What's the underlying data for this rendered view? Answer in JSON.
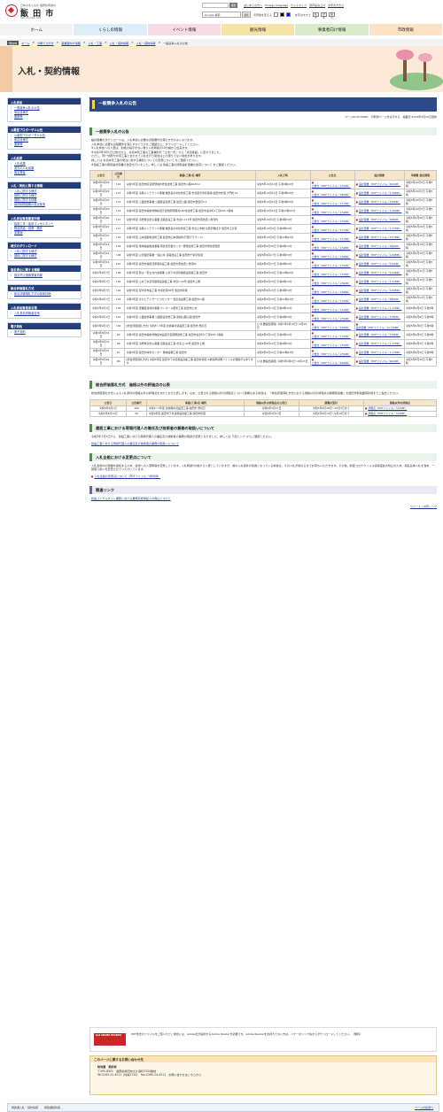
{
  "header": {
    "city_small": "日本のまんなか 長野県南信州 信州",
    "city_name": "飯 田 市",
    "city_en": "Iida City Web Site",
    "search_button": "検索",
    "top_links": [
      "はじめての方へ",
      "Foreign language",
      "サイトマップ",
      "音声読み上げ",
      "文字の大きさ"
    ],
    "google_label": "Google 検索",
    "google_button": "検索",
    "color_label": "背景色を変える",
    "font_label": "文字の大きさ",
    "font_buttons": [
      "拡大",
      "標準",
      "縮小"
    ]
  },
  "gnav": [
    {
      "label": "ホーム",
      "color": "#f3f3f3"
    },
    {
      "label": "くらしの情報",
      "color": "#ddeef9"
    },
    {
      "label": "イベント情報",
      "color": "#f7dce6"
    },
    {
      "label": "観光情報",
      "color": "#f6e3a8"
    },
    {
      "label": "事業者向け情報",
      "color": "#d9ebc8"
    },
    {
      "label": "市政情報",
      "color": "#fde2c4"
    }
  ],
  "breadcrumb": {
    "current": "現在地",
    "items": [
      "ホーム",
      "分類でさがす",
      "事業者向け情報",
      "入札・工事",
      "入札・契約情報",
      "入札・契約情報",
      "一般競争入札の公告"
    ]
  },
  "banner_title": "入札・契約情報",
  "sidebar": [
    {
      "title": "入札参加",
      "items": [
        "一般競争入札の公告",
        "申請書様式",
        "要綱等"
      ]
    },
    {
      "title": "公募型プロポーザル公告",
      "items": [
        "公募型プロポーザル公告",
        "申請書様式",
        "要綱等"
      ]
    },
    {
      "title": "入札結果",
      "items": [
        "入札結果",
        "過去の入札結果",
        "指名業者"
      ]
    },
    {
      "title": "入札・契約に関する情報",
      "items": [
        "入札に関する様式",
        "契約に関する様式",
        "契約に関する情報",
        "最低制限価格の設定基準"
      ]
    },
    {
      "title": "入札参加資格審査申請",
      "items": [
        "建設工事・建設コンサルタント",
        "物品供給・役務・委託",
        "変更届"
      ]
    },
    {
      "title": "様式のダウンロード",
      "items": [
        "入札に関する様式",
        "契約に関する様式"
      ]
    },
    {
      "title": "指名停止に関する情報",
      "items": [
        "指名停止措置業者情報"
      ]
    },
    {
      "title": "総合評価落札方式",
      "items": [
        "総合評価落札方式の技術評価"
      ]
    },
    {
      "title": "入札参加資格者名簿",
      "items": [
        "入札参加資格者名簿"
      ]
    },
    {
      "title": "電子契約",
      "items": [
        "電子契約"
      ]
    }
  ],
  "main": {
    "page_title": "一般競争入札の公告",
    "page_meta": "ページID:0079687　印刷用ページを表示する　掲載日:2023年9月29日更新",
    "sec1_title": "一般競争入札の公告",
    "sec1_text": [
      "設計図書のダウンロードは、入札参加に必要な資格要件を満たす方のみとなります。",
      "入札参加に必要な資格要件を満たすかどうかをご確認の上、ダウンロードしてください。",
      "※入札参加への入室は、別紙の指示がない限り入札時間の10分前から出来ます。",
      "※令和3年4月1日公告分から、水道本管工事の工事種別が「土木一式」から「水道施設」に変わりました。",
      "ただし、同一箇所や水道工事と合わせて入札を行う場合はこの限りでない場合があります。",
      "詳しくは 水道本管工事の発注に関する種別についての変更について をご確認ください。",
      "※建設工事の閲覧設計図書の改定を行いました。詳しくは 建設工事の閲覧設計図書の改定について をご確認ください。"
    ],
    "table_headers": [
      "公告日",
      "公告番号",
      "事業(工事)名 場所",
      "入札日時",
      "公告文",
      "設計図書",
      "申請書 提出期限"
    ],
    "rows": [
      {
        "date": "令和5年9月29日",
        "no": "116",
        "name": "令和5年度 飯田市区道能登線外修性改修工事 飯田市川路6428-2",
        "bid": "令和5年10月10日 午前9時30分",
        "notice": "公告文（PDFファイル／175KB）",
        "design": "設計図書（PDFファイル／400KB）",
        "deadline": "令和5年10月3日 午後5時"
      },
      {
        "date": "令和5年9月29日",
        "no": "115",
        "name": "令和5年度 滝路メンテナンス事業 橋梁長寿命化修繕工事 市道座光寺松尾線 飯田市松尾 大門町15",
        "bid": "令和5年10月10日 午前9時30分",
        "notice": "公告文（PDFファイル／180KB）",
        "design": "設計図書（PDFファイル／4.49MB）",
        "deadline": "令和5年10月3日 午後5時"
      },
      {
        "date": "令和5年9月29日",
        "no": "114",
        "name": "令和5年度 公園改修事業 公園施設改修工事 飯田公園 飯田市愛宕町2-1",
        "bid": "令和5年10月10日 午前9時50分",
        "notice": "公告文（PDFファイル／177KB）",
        "design": "設計図書（PDFファイル／376KB）",
        "deadline": "令和5年10月3日 午後5時"
      },
      {
        "date": "令和5年9月29日",
        "no": "113",
        "name": "令和5年度 飯田市美術博物館展示室他照明器具LED化改修工事 飯田市追手町2丁目655-7番地",
        "bid": "令和5年10月10日 午前10時10分",
        "notice": "公告文（PDFファイル／174KB）",
        "design": "設計図書（PDFファイル／3.26MB）",
        "deadline": "令和5年10月3日 午後5時"
      },
      {
        "date": "令和5年9月22日",
        "no": "112",
        "name": "令和5年度 滝壁緊急防災事業 道路改良工事 市道3-173号 飯田市南信濃八重河内",
        "bid": "令和5年10月4日 午前9時30分",
        "notice": "公告文（PDFファイル／175KB）",
        "design": "設計図書（PDFファイル／458KB）",
        "deadline": "令和5年9月26日 午後5時"
      },
      {
        "date": "令和5年9月22日",
        "no": "111",
        "name": "令和5年度 滝路メンテナンス事業 橋梁長寿命化修繕工事 市道上中線 鳥居沢橋ほか 飯田市上久堅",
        "bid": "令和5年10月4日 午前9時50分",
        "notice": "公告文（PDFファイル／177KB）",
        "design": "設計図書（PDFファイル／1.37MB）",
        "deadline": "令和5年9月26日 午後5時"
      },
      {
        "date": "令和5年9月22日",
        "no": "110",
        "name": "令和5年度 山本運動場改修工事 飯田市山本運動場(芦部グラウンド)",
        "bid": "令和5年10月4日 午前10時10分",
        "notice": "公告文（PDFファイル／177KB）",
        "design": "設計図書（PDFファイル／3.07MB）",
        "deadline": "令和5年9月26日 午後5時"
      },
      {
        "date": "令和5年9月14日",
        "no": "109",
        "name": "令和5年度 地域福祉推進事業 南信濃児童センター屋根改修工事 飯田市南信濃和田",
        "bid": "令和5年9月26日 午前9時30分",
        "notice": "公告文（PDFファイル／174KB）",
        "design": "設計図書（PDFファイル／284KB）",
        "deadline": "令和5年9月19日 午後5時"
      },
      {
        "date": "令和5年9月14日",
        "no": "108",
        "name": "令和5年度 災害復旧事業 一般公共 道路改良工事 飯田市千栄字佐間",
        "bid": "令和5年9月27日 午前9時30分",
        "notice": "公告文（PDFファイル／178KB）",
        "design": "設計図書（PDFファイル／1.09MB）",
        "deadline": "令和5年9月19日 午後5時"
      },
      {
        "date": "令和5年9月14日",
        "no": "107",
        "name": "令和5年度 飯田市消防団車庫新設工事 飯田市南信濃八重河内",
        "bid": "令和5年9月27日 午前9時50分",
        "notice": "公告文（PDFファイル／175KB）",
        "design": "設計図書（PDFファイル／512KB）",
        "deadline": "令和5年9月19日 午後5時"
      },
      {
        "date": "令和5年9月7日",
        "no": "106",
        "name": "令和5年度 防災・安全交付金事業 公共下水道管路施設改築工事 飯田市",
        "bid": "令和5年9月20日 午前10時00分",
        "notice": "公告文（PDFファイル／173KB）",
        "design": "設計図書（PDFファイル／9.04MB）",
        "deadline": "令和5年9月12日 午後5時"
      },
      {
        "date": "令和5年9月7日",
        "no": "105",
        "name": "令和5年度 公共下水道管路施設改築工事 市道1-40号 飯田市上郷",
        "bid": "令和5年9月20日 午前9時30分",
        "notice": "公告文（PDFファイル／176KB）",
        "design": "設計図書（PDFファイル／2.51MB）",
        "deadline": "令和5年9月12日 午後5時"
      },
      {
        "date": "令和5年9月7日",
        "no": "104",
        "name": "令和5年度 配水管布設工事 市道松尾36号 飯田市松尾",
        "bid": "令和5年9月20日 午前9時50分",
        "notice": "公告文（PDFファイル／178KB）",
        "design": "設計図書（PDFファイル／2.00MB）",
        "deadline": "令和5年9月12日 午後5時"
      },
      {
        "date": "令和5年9月7日",
        "no": "103",
        "name": "令和5年度 かわじデイサービスセンター 受変電設備工事 飯田市川路",
        "bid": "令和5年9月20日 午前10時10分",
        "notice": "公告文（PDFファイル／174KB）",
        "design": "設計図書（PDFファイル／284KB）",
        "deadline": "令和5年9月12日 午後5時"
      },
      {
        "date": "令和5年9月1日",
        "no": "102",
        "name": "令和5年度 農業集落排水事業 マンホール更新工事 飯田市上村",
        "bid": "令和5年9月13日 午前9時30分",
        "notice": "公告文（PDFファイル／174KB）",
        "design": "設計図書（PDFファイル／1.11MB）",
        "deadline": "令和5年9月6日 午後5時"
      },
      {
        "date": "令和5年9月1日",
        "no": "101",
        "name": "令和5年度 公園改修事業 公園施設改修工事 風越山麓公園 飯田市",
        "bid": "令和5年9月13日 午前9時50分",
        "notice": "公告文（PDFファイル／175KB）",
        "design": "設計図書（PDFファイル／378KB）",
        "deadline": "令和5年9月6日 午後5時"
      },
      {
        "date": "令和5年9月1日",
        "no": "100",
        "name": "[総合評価落札方式] 令和5～7年度 診療等水道設置工事 飯田市 鼎切石",
        "bid": "[入札書提出期間] 令和5年9月14日～9月20日",
        "notice": "公告文（PDFファイル／228KB）",
        "design": "設計図書（PDFファイル／11.15MB）",
        "deadline": "令和5年9月6日 午後5時"
      },
      {
        "date": "令和5年8月31日",
        "no": "99",
        "name": "令和5年度 飯田市美術博物館常設展示室照明改修工事 飯田市追手町2丁目655-7番地",
        "bid": "令和5年9月12日 午前9時30分",
        "notice": "公告文（PDFファイル／174KB）",
        "design": "設計図書（PDFファイル／378KB）",
        "deadline": "令和5年9月5日 午後5時"
      },
      {
        "date": "令和5年8月31日",
        "no": "98",
        "name": "令和5年度 滝壁緊急防災事業 道路改良工事 市道上-40号 飯田市上郷",
        "bid": "令和5年9月12日 午前9時50分",
        "notice": "公告文（PDFファイル／175KB）",
        "design": "設計図書（PDFファイル／1.15MB）",
        "deadline": "令和5年9月5日 午後5時"
      },
      {
        "date": "令和5年8月31日",
        "no": "97",
        "name": "令和5年度 飯田市浄化センター 機械設備工事 飯田市",
        "bid": "令和5年9月12日 午前10時10分",
        "notice": "公告文（PDFファイル／175KB）",
        "design": "設計図書（PDFファイル／1.17MB）",
        "deadline": "令和5年9月5日 午後5時"
      },
      {
        "date": "令和5年8月24日",
        "no": "96",
        "name": "[総合評価落札方式] 令和5年度 飯田市下水道施設改築工事 飯田市松尾 ※参加申請書ファイルの価値がもあります",
        "bid": "[入札書提出期間] 令和5年9月6日～9月13日",
        "notice": "公告文（PDFファイル／268KB）",
        "design": "設計図書（PDFファイル／962KB）",
        "deadline": "令和5年8月30日 午後5時"
      }
    ],
    "sec2_title": "総合評価落札方式　価格以外の評価点の公表",
    "sec2_text": "総合評価落札方式による入札案件の価格以外の評価点を次のとおり公表します。なお、公表される価格以外の評価点について疑義のある場合は、「総合評価落札方式における価格以外の評価点の疑義照会書」を飯田市財政課契約係までご提出ください。",
    "sec2_headers": [
      "公告日",
      "公告番号",
      "事業(工事)名 場所",
      "価格以外の評価点の公表日",
      "疑義の受付",
      "価格以外の評価点"
    ],
    "sec2_rows": [
      {
        "date": "令和5年9月1日",
        "no": "100",
        "name": "令和5～7年度 診療等水道設置工事 飯田市 鼎切石",
        "pub": "令和5年9月27日",
        "accept": "令和5年9月28日～10月3日まで",
        "file": "評価点（PDFファイル／111KB）"
      },
      {
        "date": "令和5年8月24日",
        "no": "96",
        "name": "令和5年度 飯田市下水道施設改築工事 飯田市松尾",
        "pub": "令和5年9月13日",
        "accept": "令和5年9月14日～9月19日まで",
        "file": "評価点（PDFファイル／110KB）"
      }
    ],
    "sec3_title": "建設工事における現場代理人の兼任及び技術者の兼務の取扱いについて",
    "sec3_text": "令和5年1月1日から、建設工事における現場代理人の兼任及び技術者の兼務の取扱が変更となりました。詳しくは 下記リンク からご確認ください。",
    "sec3_link": "建設工事における現場代理人の兼任及び技術者の兼務の取扱いについて",
    "sec4_title": "入札全般における変更点について",
    "sec4_text": "入札会場内の混雑を緩和するため、会場への入室時間を変更しています。入札時間5分前から入室としていますが、前の入札案件が延長となっている場合は、その入札が終わるまでお待ちいただきます。その他、新型コロナウイルス感染症拡大防止のため、指名競争入札を含め、一部取り扱いを変更させていただいています。",
    "sec4_link": "入札全般の変更点について（PDFファイル／489KB）",
    "related_title": "関連リンク",
    "related_link": "建設コンサルタント業務における業務完成保証人の廃止について",
    "tweet": "ツイート / 共有リンク",
    "pdf_note": "PDF形式のファイルをご覧いただく場合には、Adobe社が提供するAdobe Readerが必要です。Adobe Readerをお持ちでない方は、バナーのリンク先からダウンロードしてください。（無料）",
    "adobe_text": "Get ADOBE READER",
    "contact_title": "このページに関するお問い合わせ先",
    "contact_lines": [
      "財政課　契約係",
      "〒395-8501　長野県飯田市大久保町2534番地",
      "Tel:0265-22-4511（内線2134）　Fax:0265-24-4511　お問い合わせはこちらから"
    ],
    "return_top": "ページの先頭へ",
    "lower_box": [
      "財政課入札・契約情報",
      "財政課契約係"
    ]
  }
}
